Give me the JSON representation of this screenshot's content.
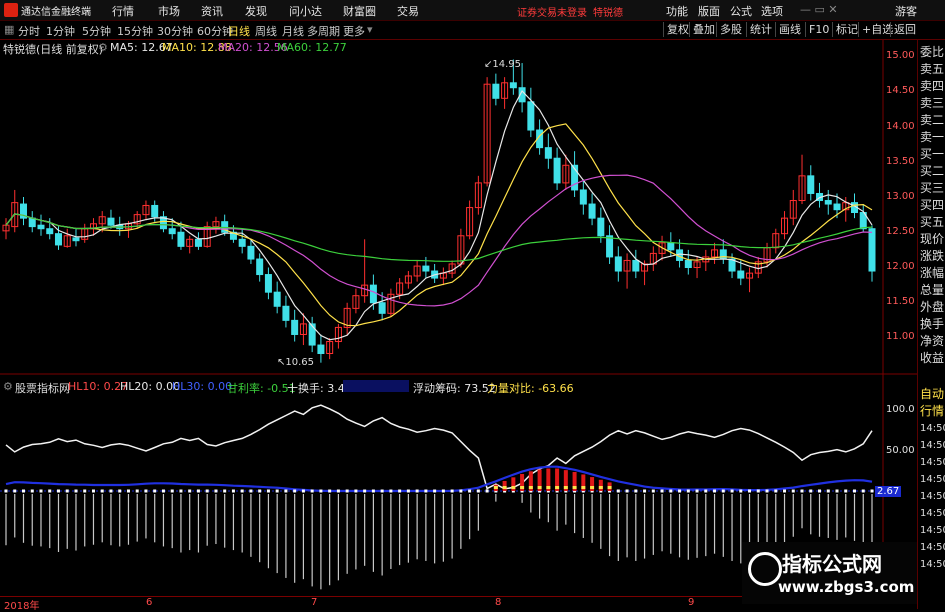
{
  "app": {
    "title": "通达信金融终端"
  },
  "menu": {
    "items": [
      "行情",
      "市场",
      "资讯",
      "发现",
      "问小达",
      "财富圈",
      "交易"
    ],
    "warning": "证券交易未登录",
    "stock_name": "特锐德",
    "right_items": [
      "功能",
      "版面",
      "公式",
      "选项"
    ],
    "guest": "游客"
  },
  "toolbar": {
    "periods": [
      "分时",
      "1分钟",
      "5分钟",
      "15分钟",
      "30分钟",
      "60分钟",
      "日线",
      "周线",
      "月线",
      "多周期",
      "更多"
    ],
    "active_period": "日线",
    "right_buttons": [
      "复权",
      "叠加",
      "多股",
      "统计",
      "画线",
      "F10",
      "标记",
      "+自选",
      "返回"
    ]
  },
  "info": {
    "title": "特锐德(日线 前复权)",
    "ma": [
      {
        "label": "MA5: 12.67",
        "color": "#e8e8e8"
      },
      {
        "label": "MA10: 12.88",
        "color": "#ffe14a"
      },
      {
        "label": "MA20: 12.56",
        "color": "#d050d0"
      },
      {
        "label": "MA60: 12.77",
        "color": "#3cd03c"
      }
    ]
  },
  "indicator_info": {
    "title": "股票指标网",
    "items": [
      {
        "label": "HL10: 0.27",
        "color": "#ff4a4a"
      },
      {
        "label": "HL20: 0.00",
        "color": "#e8e8e8"
      },
      {
        "label": "HL30: 0.00",
        "color": "#4060ff"
      },
      {
        "label": "甘利率: -0.51",
        "color": "#3cd03c"
      },
      {
        "label": "十换手: 3.40",
        "color": "#e8e8e8"
      },
      {
        "label": "浮动筹码: 73.52",
        "color": "#e8e8e8"
      },
      {
        "label": "力量对比: -63.66",
        "color": "#ffe14a"
      }
    ]
  },
  "right_panel": {
    "items": [
      "委比",
      "卖五",
      "卖四",
      "卖三",
      "卖二",
      "卖一",
      "买一",
      "买二",
      "买三",
      "买四",
      "买五",
      "现价",
      "涨跌",
      "涨幅",
      "总量",
      "外盘",
      "换手",
      "净资",
      "收益"
    ],
    "tabs": [
      "自动",
      "行情"
    ],
    "times": [
      "14:50",
      "14:50",
      "14:50",
      "14:50",
      "14:50",
      "14:50",
      "14:50",
      "14:50",
      "14:50"
    ]
  },
  "price_axis": [
    "15.00",
    "14.50",
    "14.00",
    "13.50",
    "13.00",
    "12.50",
    "12.00",
    "11.50",
    "11.00"
  ],
  "indicator_axis": [
    "100.0",
    "50.00",
    "2.67"
  ],
  "annotations": {
    "high": "14.95",
    "low": "10.65"
  },
  "dates": [
    "2018年",
    "6",
    "7",
    "8",
    "9"
  ],
  "watermark": {
    "title": "指标公式网",
    "url": "www.zbgs3.com"
  },
  "colors": {
    "up": "#ff3030",
    "down": "#40e0e8",
    "ma5": "#e8e8e8",
    "ma10": "#ffe14a",
    "ma20": "#d050d0",
    "ma60": "#3cd03c"
  },
  "chart_data": {
    "type": "candlestick",
    "ylim": [
      10.5,
      15.1
    ],
    "candles": [
      [
        12.52,
        12.7,
        12.4,
        12.6
      ],
      [
        12.58,
        13.1,
        12.5,
        12.92
      ],
      [
        12.9,
        13.0,
        12.6,
        12.7
      ],
      [
        12.7,
        12.8,
        12.5,
        12.58
      ],
      [
        12.6,
        12.75,
        12.45,
        12.55
      ],
      [
        12.55,
        12.7,
        12.4,
        12.48
      ],
      [
        12.48,
        12.6,
        12.25,
        12.32
      ],
      [
        12.3,
        12.55,
        12.28,
        12.45
      ],
      [
        12.42,
        12.55,
        12.3,
        12.38
      ],
      [
        12.4,
        12.62,
        12.35,
        12.55
      ],
      [
        12.55,
        12.7,
        12.45,
        12.62
      ],
      [
        12.62,
        12.8,
        12.5,
        12.72
      ],
      [
        12.7,
        12.82,
        12.55,
        12.6
      ],
      [
        12.6,
        12.72,
        12.45,
        12.55
      ],
      [
        12.55,
        12.66,
        12.42,
        12.62
      ],
      [
        12.62,
        12.8,
        12.55,
        12.75
      ],
      [
        12.75,
        12.95,
        12.68,
        12.88
      ],
      [
        12.88,
        12.95,
        12.65,
        12.72
      ],
      [
        12.72,
        12.8,
        12.5,
        12.55
      ],
      [
        12.55,
        12.7,
        12.4,
        12.48
      ],
      [
        12.5,
        12.65,
        12.25,
        12.3
      ],
      [
        12.3,
        12.45,
        12.2,
        12.4
      ],
      [
        12.4,
        12.5,
        12.25,
        12.3
      ],
      [
        12.3,
        12.65,
        12.28,
        12.58
      ],
      [
        12.58,
        12.72,
        12.48,
        12.65
      ],
      [
        12.65,
        12.75,
        12.45,
        12.5
      ],
      [
        12.5,
        12.6,
        12.35,
        12.4
      ],
      [
        12.4,
        12.55,
        12.2,
        12.3
      ],
      [
        12.3,
        12.4,
        12.05,
        12.12
      ],
      [
        12.12,
        12.2,
        11.8,
        11.9
      ],
      [
        11.9,
        12.0,
        11.55,
        11.65
      ],
      [
        11.65,
        11.8,
        11.35,
        11.45
      ],
      [
        11.45,
        11.6,
        11.15,
        11.25
      ],
      [
        11.25,
        11.4,
        10.95,
        11.05
      ],
      [
        11.05,
        11.35,
        10.9,
        11.2
      ],
      [
        11.2,
        11.3,
        10.8,
        10.9
      ],
      [
        10.9,
        11.05,
        10.65,
        10.78
      ],
      [
        10.78,
        11.0,
        10.7,
        10.95
      ],
      [
        10.95,
        11.2,
        10.85,
        11.15
      ],
      [
        11.15,
        11.5,
        11.05,
        11.42
      ],
      [
        11.42,
        11.7,
        11.35,
        11.6
      ],
      [
        11.6,
        12.4,
        11.5,
        11.75
      ],
      [
        11.75,
        11.9,
        11.4,
        11.5
      ],
      [
        11.5,
        11.65,
        11.25,
        11.35
      ],
      [
        11.35,
        11.7,
        11.3,
        11.62
      ],
      [
        11.62,
        11.85,
        11.55,
        11.78
      ],
      [
        11.78,
        11.95,
        11.7,
        11.88
      ],
      [
        11.88,
        12.1,
        11.8,
        12.02
      ],
      [
        12.02,
        12.15,
        11.85,
        11.95
      ],
      [
        11.95,
        12.05,
        11.78,
        11.85
      ],
      [
        11.85,
        12.0,
        11.75,
        11.92
      ],
      [
        11.92,
        12.1,
        11.85,
        12.05
      ],
      [
        12.05,
        12.55,
        12.0,
        12.45
      ],
      [
        12.45,
        12.95,
        12.4,
        12.85
      ],
      [
        12.85,
        13.3,
        12.75,
        13.2
      ],
      [
        13.2,
        14.7,
        13.15,
        14.6
      ],
      [
        14.6,
        14.75,
        14.3,
        14.4
      ],
      [
        14.4,
        14.7,
        14.25,
        14.62
      ],
      [
        14.62,
        14.95,
        14.45,
        14.55
      ],
      [
        14.55,
        14.9,
        14.2,
        14.35
      ],
      [
        14.35,
        14.55,
        13.85,
        13.95
      ],
      [
        13.95,
        14.1,
        13.6,
        13.7
      ],
      [
        13.7,
        13.9,
        13.4,
        13.55
      ],
      [
        13.55,
        13.7,
        13.1,
        13.2
      ],
      [
        13.2,
        13.6,
        13.1,
        13.45
      ],
      [
        13.45,
        13.65,
        13.0,
        13.1
      ],
      [
        13.1,
        13.25,
        12.75,
        12.9
      ],
      [
        12.9,
        13.05,
        12.6,
        12.7
      ],
      [
        12.7,
        12.85,
        12.35,
        12.45
      ],
      [
        12.45,
        12.6,
        12.05,
        12.15
      ],
      [
        12.15,
        12.3,
        11.8,
        11.95
      ],
      [
        11.95,
        12.2,
        11.7,
        12.1
      ],
      [
        12.1,
        12.25,
        11.85,
        11.95
      ],
      [
        11.95,
        12.1,
        11.75,
        12.05
      ],
      [
        12.05,
        12.3,
        11.95,
        12.2
      ],
      [
        12.2,
        12.45,
        12.1,
        12.35
      ],
      [
        12.35,
        12.5,
        12.15,
        12.25
      ],
      [
        12.25,
        12.4,
        12.0,
        12.1
      ],
      [
        12.1,
        12.25,
        11.9,
        12.0
      ],
      [
        12.0,
        12.15,
        11.85,
        12.08
      ],
      [
        12.08,
        12.25,
        11.95,
        12.15
      ],
      [
        12.15,
        12.35,
        12.05,
        12.25
      ],
      [
        12.25,
        12.4,
        12.05,
        12.12
      ],
      [
        12.12,
        12.2,
        11.85,
        11.95
      ],
      [
        11.95,
        12.1,
        11.75,
        11.85
      ],
      [
        11.85,
        12.0,
        11.65,
        11.92
      ],
      [
        11.92,
        12.15,
        11.85,
        12.08
      ],
      [
        12.08,
        12.35,
        12.0,
        12.28
      ],
      [
        12.28,
        12.55,
        12.2,
        12.48
      ],
      [
        12.48,
        12.8,
        12.4,
        12.7
      ],
      [
        12.7,
        13.1,
        12.6,
        12.95
      ],
      [
        12.95,
        13.6,
        12.9,
        13.3
      ],
      [
        13.3,
        13.45,
        12.95,
        13.05
      ],
      [
        13.05,
        13.2,
        12.85,
        12.95
      ],
      [
        12.95,
        13.1,
        12.75,
        12.9
      ],
      [
        12.9,
        13.05,
        12.7,
        12.82
      ],
      [
        12.82,
        13.0,
        12.65,
        12.92
      ],
      [
        12.92,
        13.05,
        12.7,
        12.78
      ],
      [
        12.78,
        12.9,
        12.5,
        12.55
      ],
      [
        12.55,
        12.6,
        11.8,
        11.95
      ]
    ]
  }
}
